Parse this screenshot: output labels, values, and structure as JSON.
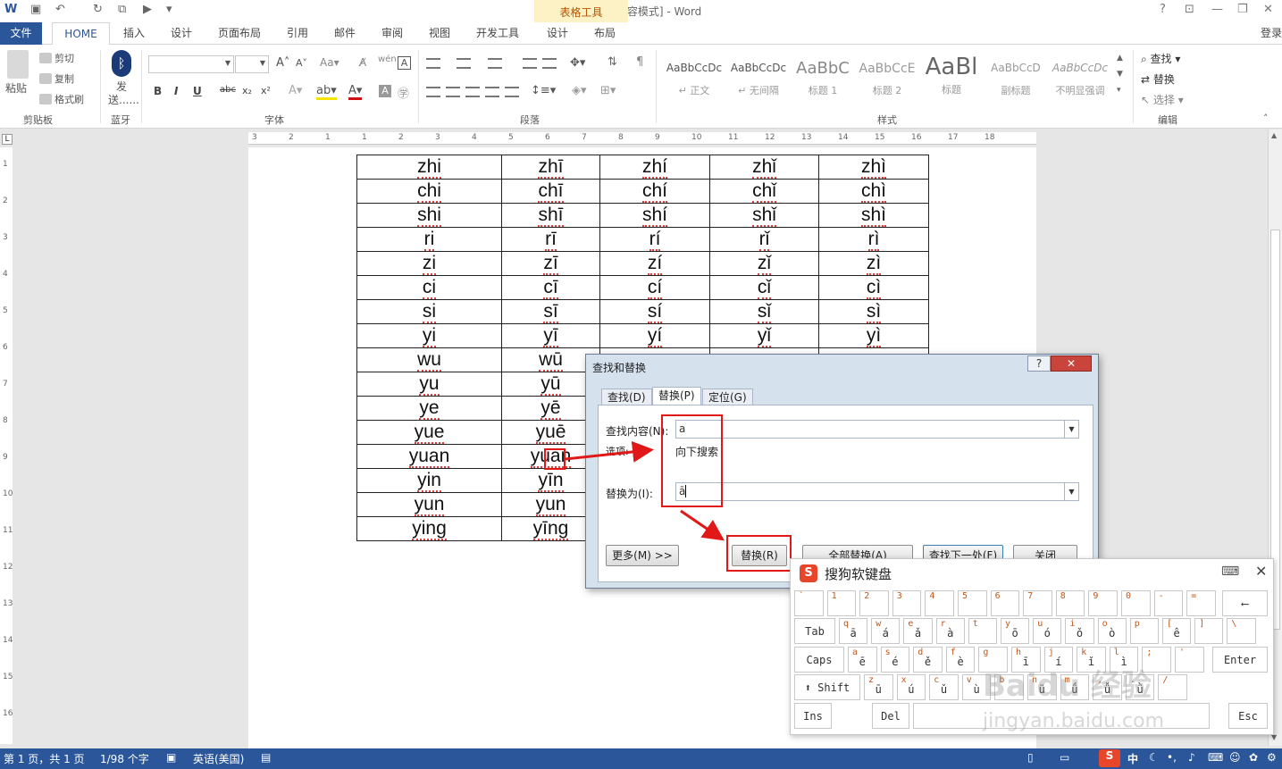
{
  "window": {
    "title": "文档1 [兼容模式] - Word",
    "table_tools": "表格工具",
    "help": "?",
    "login": "登录"
  },
  "tabs": [
    "文件",
    "HOME",
    "插入",
    "设计",
    "页面布局",
    "引用",
    "邮件",
    "审阅",
    "视图",
    "开发工具",
    "设计",
    "布局"
  ],
  "ribbon": {
    "clipboard": {
      "paste": "粘贴",
      "cut": "剪切",
      "copy": "复制",
      "format_painter": "格式刷",
      "label": "剪贴板"
    },
    "bluetooth": {
      "send": "发送......",
      "label": "蓝牙"
    },
    "font": {
      "label": "字体",
      "bold": "B",
      "italic": "I",
      "underline": "U",
      "strike": "abc",
      "sub": "x₂",
      "sup": "x²"
    },
    "paragraph": {
      "label": "段落"
    },
    "styles": {
      "label": "样式",
      "items": [
        {
          "preview": "AaBbCcDc",
          "name": "↵ 正文"
        },
        {
          "preview": "AaBbCcDc",
          "name": "↵ 无间隔"
        },
        {
          "preview": "AaBbC",
          "name": "标题 1"
        },
        {
          "preview": "AaBbCcE",
          "name": "标题 2"
        },
        {
          "preview": "AaBl",
          "name": "标题"
        },
        {
          "preview": "AaBbCcD",
          "name": "副标题"
        },
        {
          "preview": "AaBbCcDc",
          "name": "不明显强调"
        }
      ]
    },
    "editing": {
      "label": "编辑",
      "find": "查找",
      "replace": "替换",
      "select": "选择"
    }
  },
  "ruler": {
    "h": [
      "3",
      "2",
      "1",
      "1",
      "2",
      "3",
      "4",
      "5",
      "6",
      "7",
      "8",
      "9",
      "10",
      "11",
      "12",
      "13",
      "14",
      "15",
      "16",
      "17",
      "18"
    ],
    "v": [
      "1",
      "2",
      "3",
      "4",
      "5",
      "6",
      "7",
      "8",
      "9",
      "10",
      "11",
      "12",
      "13",
      "14",
      "15",
      "16"
    ]
  },
  "table": [
    [
      "zhi",
      "zhī",
      "zhí",
      "zhǐ",
      "zhì"
    ],
    [
      "chi",
      "chī",
      "chí",
      "chǐ",
      "chì"
    ],
    [
      "shi",
      "shī",
      "shí",
      "shǐ",
      "shì"
    ],
    [
      "ri",
      "rī",
      "rí",
      "rǐ",
      "rì"
    ],
    [
      "zi",
      "zī",
      "zí",
      "zǐ",
      "zì"
    ],
    [
      "ci",
      "cī",
      "cí",
      "cǐ",
      "cì"
    ],
    [
      "si",
      "sī",
      "sí",
      "sǐ",
      "sì"
    ],
    [
      "yi",
      "yī",
      "yí",
      "yǐ",
      "yì"
    ],
    [
      "wu",
      "wū",
      "",
      "",
      ""
    ],
    [
      "yu",
      "yū",
      "",
      "",
      ""
    ],
    [
      "ye",
      "yē",
      "",
      "",
      ""
    ],
    [
      "yue",
      "yuē",
      "",
      "",
      ""
    ],
    [
      "yuan",
      "yuān",
      "",
      "",
      ""
    ],
    [
      "yin",
      "yīn",
      "",
      "",
      ""
    ],
    [
      "yun",
      "yun",
      "",
      "",
      ""
    ],
    [
      "ying",
      "yīng",
      "",
      "",
      ""
    ]
  ],
  "dialog": {
    "title": "查找和替换",
    "help": "?",
    "close": "✕",
    "tabs": [
      "查找(D)",
      "替换(P)",
      "定位(G)"
    ],
    "find_label": "查找内容(N):",
    "find_value": "a",
    "options_label": "选项:",
    "options_value": "向下搜索",
    "replace_label": "替换为(I):",
    "replace_value": "ā",
    "more_btn": "更多(M) >>",
    "replace_btn": "替换(R)",
    "replace_all_btn": "全部替换(A)",
    "find_next_btn": "查找下一处(F)",
    "close_btn": "关闭"
  },
  "keyboard": {
    "title": "搜狗软键盘",
    "logo": "S",
    "row1": [
      [
        "`",
        ""
      ],
      [
        "1",
        ""
      ],
      [
        "2",
        ""
      ],
      [
        "3",
        ""
      ],
      [
        "4",
        ""
      ],
      [
        "5",
        ""
      ],
      [
        "6",
        ""
      ],
      [
        "7",
        ""
      ],
      [
        "8",
        ""
      ],
      [
        "9",
        ""
      ],
      [
        "0",
        ""
      ],
      [
        "-",
        ""
      ],
      [
        "=",
        ""
      ]
    ],
    "backspace": "⟵",
    "tab": "Tab",
    "row2": [
      [
        "q",
        "ā"
      ],
      [
        "w",
        "á"
      ],
      [
        "e",
        "ǎ"
      ],
      [
        "r",
        "à"
      ],
      [
        "t",
        ""
      ],
      [
        "y",
        "ō"
      ],
      [
        "u",
        "ó"
      ],
      [
        "i",
        "ǒ"
      ],
      [
        "o",
        "ò"
      ],
      [
        "p",
        ""
      ],
      [
        "[",
        "ê"
      ],
      [
        "]",
        ""
      ],
      [
        "\\",
        ""
      ]
    ],
    "caps": "Caps",
    "row3": [
      [
        "a",
        "ē"
      ],
      [
        "s",
        "é"
      ],
      [
        "d",
        "ě"
      ],
      [
        "f",
        "è"
      ],
      [
        "g",
        ""
      ],
      [
        "h",
        "ī"
      ],
      [
        "j",
        "í"
      ],
      [
        "k",
        "ǐ"
      ],
      [
        "l",
        "ì"
      ],
      [
        ";",
        ""
      ],
      [
        "'",
        ""
      ]
    ],
    "enter": "Enter",
    "shift": "⬆ Shift",
    "row4": [
      [
        "z",
        "ū"
      ],
      [
        "x",
        "ú"
      ],
      [
        "c",
        "ǔ"
      ],
      [
        "v",
        "ù"
      ],
      [
        "b",
        ""
      ],
      [
        "n",
        "ü"
      ],
      [
        "m",
        "ǘ"
      ],
      [
        ",",
        "ǚ"
      ],
      [
        ".",
        "ǜ"
      ],
      [
        "/",
        ""
      ]
    ],
    "ins": "Ins",
    "del": "Del",
    "esc": "Esc"
  },
  "watermark": {
    "line1": "Baidu 经验",
    "line2": "jingyan.baidu.com"
  },
  "status": {
    "page": "第 1 页，共 1 页",
    "words": "1/98 个字",
    "lang": "英语(美国)",
    "ime": "中"
  },
  "colors": {
    "accent": "#2b579a",
    "annotation": "#e01818",
    "dialog_bg": "#d6e1ee"
  }
}
